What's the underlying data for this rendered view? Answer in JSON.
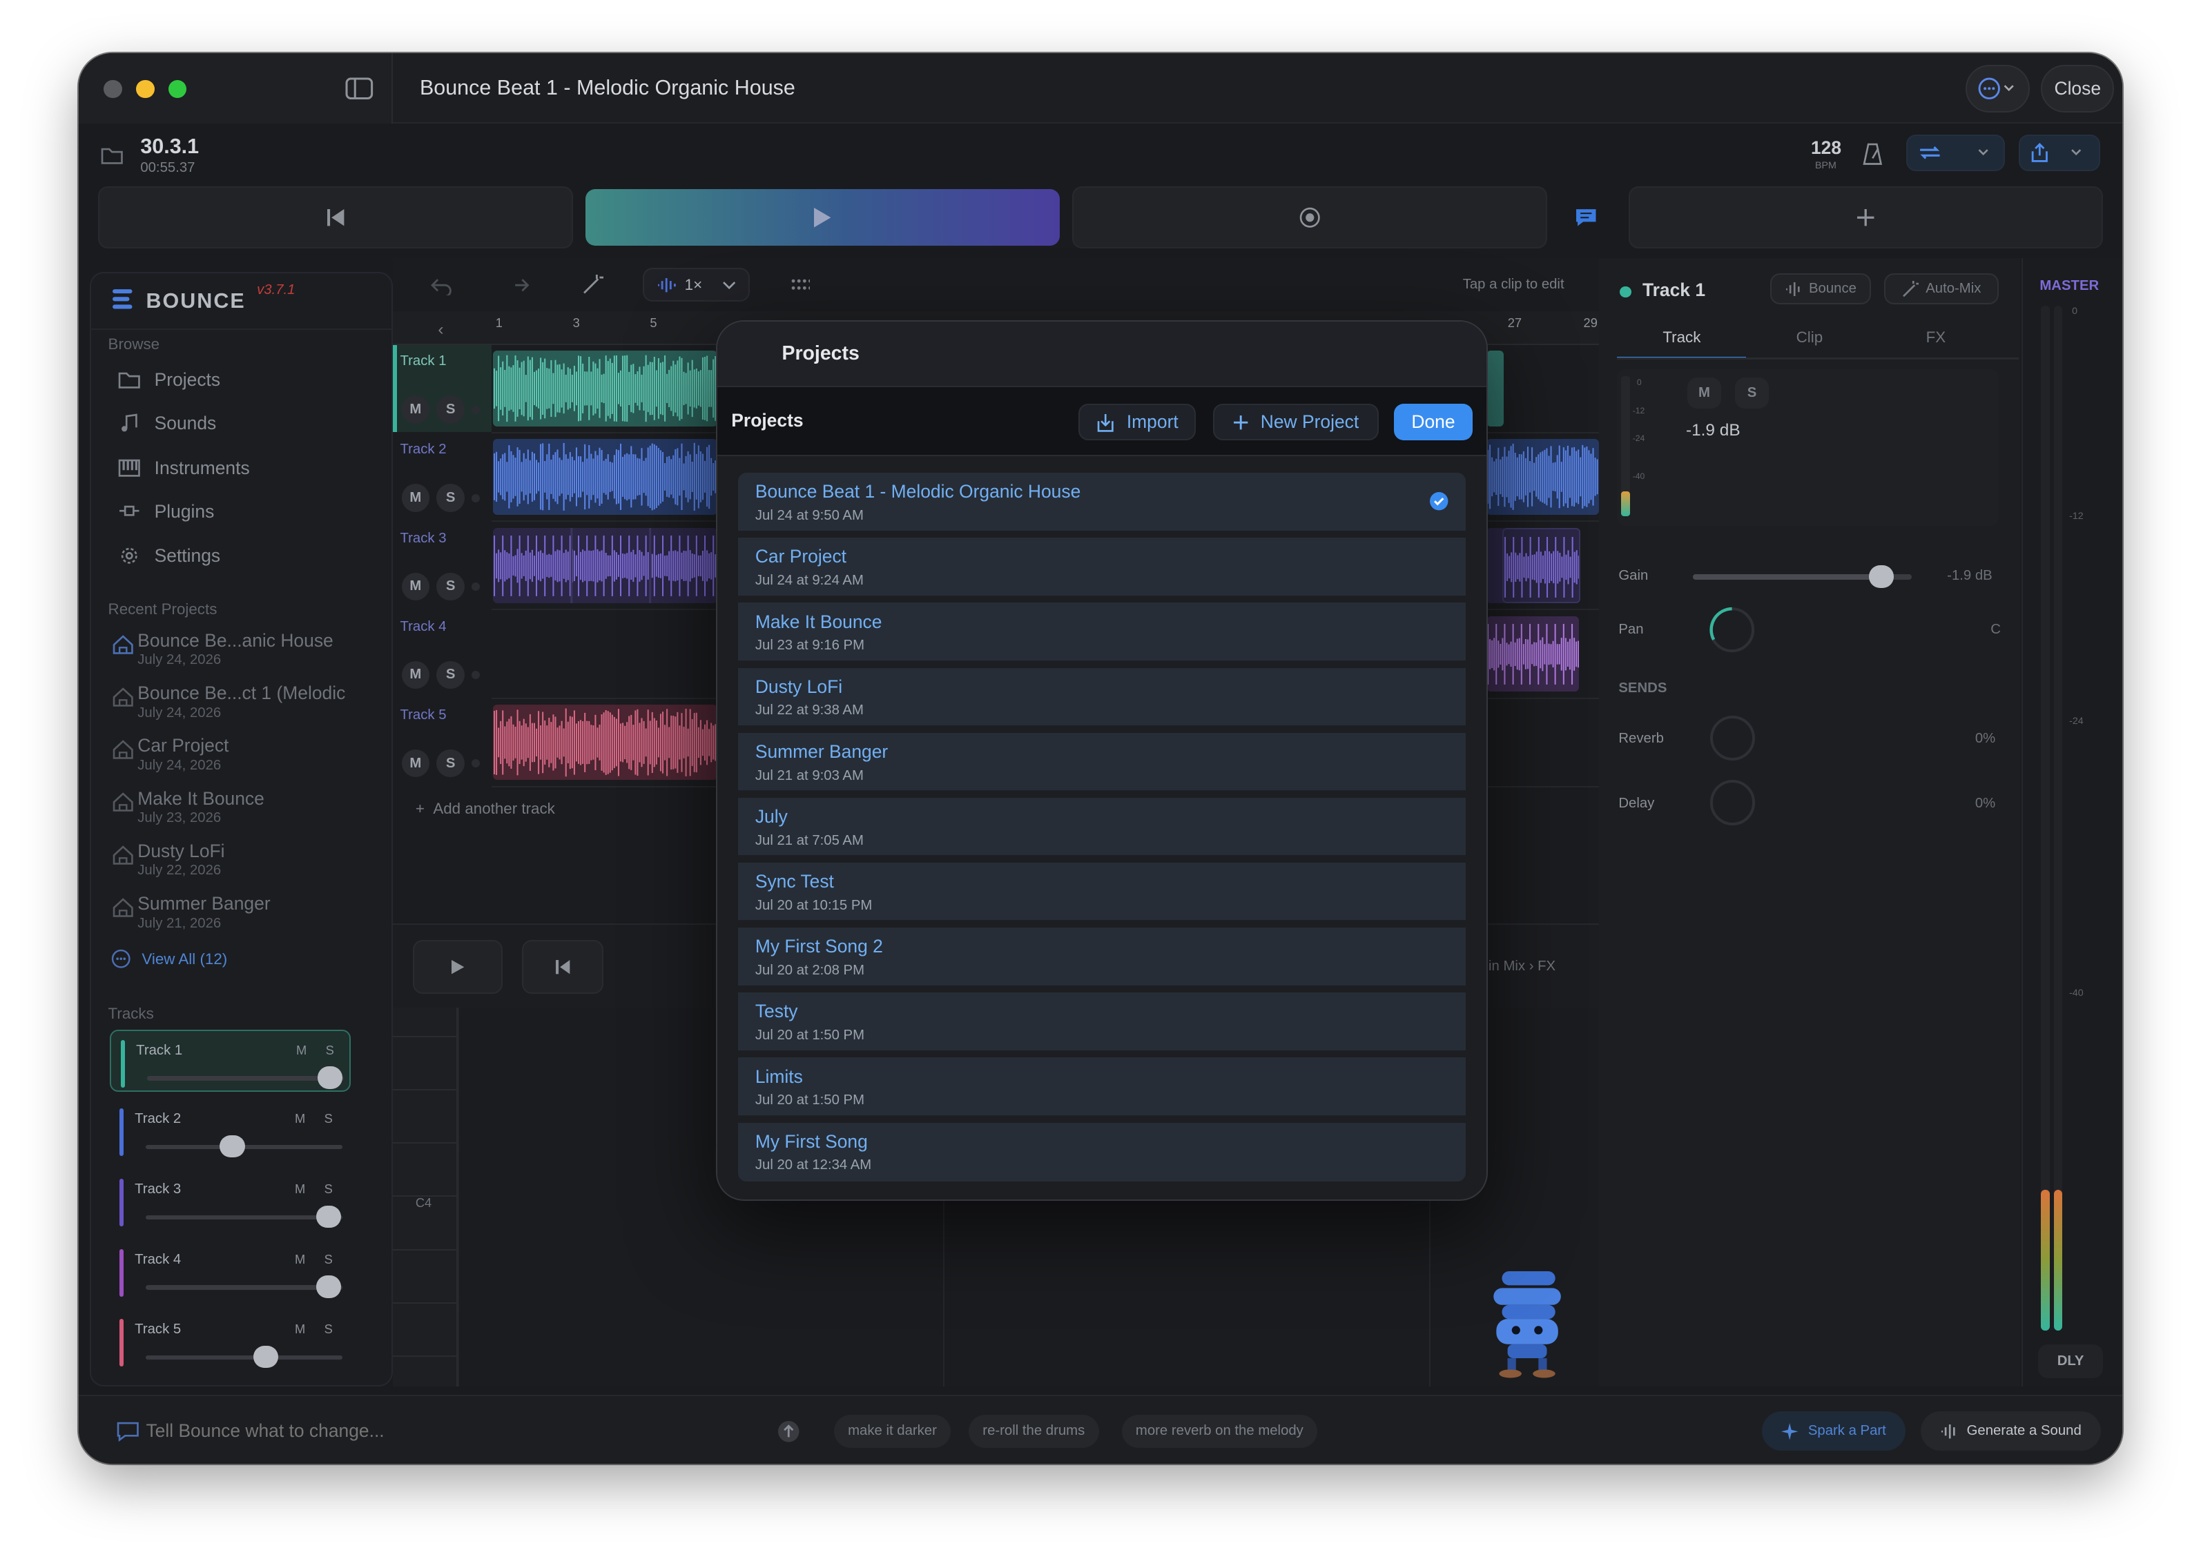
{
  "window": {
    "title": "Bounce Beat 1 - Melodic Organic House",
    "close_label": "Close"
  },
  "transport": {
    "position": "30.3.1",
    "time": "00:55.37",
    "bpm_value": "128",
    "bpm_label": "BPM"
  },
  "sidebar": {
    "brand": "BOUNCE",
    "version": "v3.7.1",
    "browse_label": "Browse",
    "nav": [
      {
        "label": "Projects",
        "icon": "folder-icon"
      },
      {
        "label": "Sounds",
        "icon": "music-note-icon"
      },
      {
        "label": "Instruments",
        "icon": "piano-icon"
      },
      {
        "label": "Plugins",
        "icon": "plug-icon"
      },
      {
        "label": "Settings",
        "icon": "gear-icon"
      }
    ],
    "recent_label": "Recent Projects",
    "recent": [
      {
        "title": "Bounce Be...anic House",
        "date": "July 24, 2026"
      },
      {
        "title": "Bounce Be...ct 1 (Melodic",
        "date": "July 24, 2026"
      },
      {
        "title": "Car Project",
        "date": "July 24, 2026"
      },
      {
        "title": "Make It Bounce",
        "date": "July 23, 2026"
      },
      {
        "title": "Dusty LoFi",
        "date": "July 22, 2026"
      },
      {
        "title": "Summer Banger",
        "date": "July 21, 2026"
      }
    ],
    "view_all": "View All (12)",
    "tracks_label": "Tracks",
    "tracks": [
      {
        "name": "Track 1",
        "mute": "M",
        "solo": "S",
        "color": "#36b59c",
        "level": 0.93
      },
      {
        "name": "Track 2",
        "mute": "M",
        "solo": "S",
        "color": "#4a6fd8",
        "level": 0.44
      },
      {
        "name": "Track 3",
        "mute": "M",
        "solo": "S",
        "color": "#6a55c8",
        "level": 0.93
      },
      {
        "name": "Track 4",
        "mute": "M",
        "solo": "S",
        "color": "#9b4fc0",
        "level": 0.93
      },
      {
        "name": "Track 5",
        "mute": "M",
        "solo": "S",
        "color": "#d55a7a",
        "level": 0.61
      }
    ]
  },
  "editor": {
    "speed": "1×",
    "hint": "Tap a clip to edit",
    "ruler": [
      "1",
      "3",
      "5",
      "27",
      "29"
    ],
    "tracks": [
      "Track 1",
      "Track 2",
      "Track 3",
      "Track 4",
      "Track 5"
    ],
    "mute": "M",
    "solo": "S",
    "add_track": "Add another track",
    "mix_hint": "e in Mix › FX",
    "note_label": "C4"
  },
  "modal": {
    "title": "Projects",
    "bar_title": "Projects",
    "import_label": "Import",
    "new_label": "New Project",
    "done_label": "Done",
    "projects": [
      {
        "title": "Bounce Beat 1 - Melodic Organic House",
        "date": "Jul 24 at 9:50 AM",
        "selected": true
      },
      {
        "title": "Car Project",
        "date": "Jul 24 at 9:24 AM"
      },
      {
        "title": "Make It Bounce",
        "date": "Jul 23 at 9:16 PM"
      },
      {
        "title": "Dusty LoFi",
        "date": "Jul 22 at 9:38 AM"
      },
      {
        "title": "Summer Banger",
        "date": "Jul 21 at 9:03 AM"
      },
      {
        "title": "July",
        "date": "Jul 21 at 7:05 AM"
      },
      {
        "title": "Sync Test",
        "date": "Jul 20 at 10:15 PM"
      },
      {
        "title": "My First Song 2",
        "date": "Jul 20 at 2:08 PM"
      },
      {
        "title": "Testy",
        "date": "Jul 20 at 1:50 PM"
      },
      {
        "title": "Limits",
        "date": "Jul 20 at 1:50 PM"
      },
      {
        "title": "My First Song",
        "date": "Jul 20 at 12:34 AM"
      }
    ]
  },
  "inspector": {
    "track_name": "Track 1",
    "bounce_label": "Bounce",
    "automix_label": "Auto-Mix",
    "tabs": [
      "Track",
      "Clip",
      "FX"
    ],
    "meter_ticks": [
      "0",
      "-12",
      "-24",
      "-40"
    ],
    "mute": "M",
    "solo": "S",
    "level_db": "-1.9 dB",
    "gain_label": "Gain",
    "gain_value": "-1.9 dB",
    "gain_level": 0.86,
    "pan_label": "Pan",
    "pan_value": "C",
    "sends_label": "SENDS",
    "reverb_label": "Reverb",
    "reverb_value": "0%",
    "delay_label": "Delay",
    "delay_value": "0%"
  },
  "master": {
    "label": "MASTER",
    "ticks": [
      "0",
      "-12",
      "-24",
      "-40"
    ],
    "dly_label": "DLY"
  },
  "prompt": {
    "placeholder": "Tell Bounce what to change...",
    "suggestions": [
      "make it darker",
      "re-roll the drums",
      "more reverb on the melody"
    ],
    "spark_label": "Spark a Part",
    "generate_label": "Generate a Sound"
  },
  "colors": {
    "accent": "#3a8df0",
    "teal": "#36b59c",
    "purple": "#7d6bd8"
  }
}
